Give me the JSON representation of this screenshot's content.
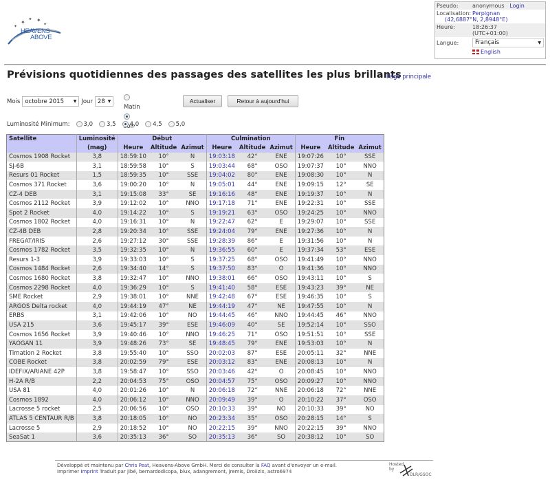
{
  "logo": {
    "line1": "HEAVENS",
    "line2": "ABOVE"
  },
  "user_panel": {
    "pseudo_label": "Pseudo:",
    "pseudo_value": "anonymous",
    "login_link": "Login",
    "location_label": "Localisation:",
    "location_value": "Perpignan",
    "coordinates": "(42,6887°N, 2,8948°E)",
    "time_label": "Heure:",
    "time_value": "18:26:37",
    "timezone": "(UTC+01:00)",
    "language_label": "Langue:",
    "language_selected": "Français",
    "english_link": "English"
  },
  "page": {
    "title": "Prévisions quotidiennes des passages des satellites les plus brillants",
    "home_link": "Page principale"
  },
  "controls": {
    "month_label": "Mois",
    "month_value": "octobre 2015",
    "day_label": "Jour",
    "day_value": "28",
    "morning_label": "Matin",
    "evening_label": "soir",
    "period_selected": "soir",
    "refresh_button": "Actualiser",
    "today_button": "Retour à aujourd'hui",
    "min_brightness_label": "Luminosité Minimum:",
    "brightness_options": [
      "3,0",
      "3,5",
      "4,0",
      "4,5",
      "5,0"
    ],
    "brightness_selected": "4,0"
  },
  "table": {
    "headers": {
      "satellite": "Satellite",
      "brightness": "Luminosité",
      "brightness_unit": "(mag)",
      "start": "Début",
      "culmination": "Culmination",
      "end": "Fin",
      "time": "Heure",
      "altitude": "Altitude",
      "azimuth": "Azimut"
    },
    "rows": [
      [
        "Cosmos 1908 Rocket",
        "3,8",
        "18:59:10",
        "10°",
        "N",
        "19:03:18",
        "42°",
        "ENE",
        "19:07:26",
        "10°",
        "SSE"
      ],
      [
        "SJ-6B",
        "3,1",
        "18:59:58",
        "10°",
        "S",
        "19:03:44",
        "68°",
        "OSO",
        "19:07:37",
        "10°",
        "NNO"
      ],
      [
        "Resurs 01 Rocket",
        "1,5",
        "18:59:35",
        "10°",
        "SSE",
        "19:04:02",
        "80°",
        "ENE",
        "19:08:30",
        "10°",
        "N"
      ],
      [
        "Cosmos 371 Rocket",
        "3,6",
        "19:00:20",
        "10°",
        "N",
        "19:05:01",
        "44°",
        "ENE",
        "19:09:15",
        "12°",
        "SE"
      ],
      [
        "CZ-4 DEB",
        "3,1",
        "19:15:08",
        "33°",
        "SE",
        "19:16:16",
        "48°",
        "ENE",
        "19:19:37",
        "10°",
        "N"
      ],
      [
        "Cosmos 2112 Rocket",
        "3,9",
        "19:12:02",
        "10°",
        "NNO",
        "19:17:18",
        "71°",
        "ENE",
        "19:22:31",
        "10°",
        "SSE"
      ],
      [
        "Spot 2 Rocket",
        "4,0",
        "19:14:22",
        "10°",
        "S",
        "19:19:21",
        "63°",
        "OSO",
        "19:24:25",
        "10°",
        "NNO"
      ],
      [
        "Cosmos 1802 Rocket",
        "4,0",
        "19:16:31",
        "10°",
        "N",
        "19:22:47",
        "62°",
        "E",
        "19:29:07",
        "10°",
        "SSE"
      ],
      [
        "CZ-4B DEB",
        "2,8",
        "19:20:34",
        "10°",
        "SSE",
        "19:24:04",
        "79°",
        "ENE",
        "19:27:36",
        "10°",
        "N"
      ],
      [
        "FREGAT/IRIS",
        "2,6",
        "19:27:12",
        "30°",
        "SSE",
        "19:28:39",
        "86°",
        "E",
        "19:31:56",
        "10°",
        "N"
      ],
      [
        "Cosmos 1782 Rocket",
        "3,5",
        "19:32:35",
        "10°",
        "N",
        "19:36:55",
        "60°",
        "E",
        "19:37:34",
        "53°",
        "ESE"
      ],
      [
        "Resurs 1-3",
        "3,9",
        "19:33:03",
        "10°",
        "S",
        "19:37:25",
        "68°",
        "OSO",
        "19:41:49",
        "10°",
        "NNO"
      ],
      [
        "Cosmos 1484 Rocket",
        "2,6",
        "19:34:40",
        "14°",
        "S",
        "19:37:50",
        "83°",
        "O",
        "19:41:36",
        "10°",
        "NNO"
      ],
      [
        "Cosmos 1680 Rocket",
        "3,8",
        "19:32:47",
        "10°",
        "NNO",
        "19:38:01",
        "66°",
        "OSO",
        "19:43:11",
        "10°",
        "S"
      ],
      [
        "Cosmos 2298 Rocket",
        "4,0",
        "19:36:29",
        "10°",
        "S",
        "19:41:40",
        "58°",
        "ESE",
        "19:43:23",
        "39°",
        "NE"
      ],
      [
        "SME Rocket",
        "2,9",
        "19:38:01",
        "10°",
        "NNE",
        "19:42:48",
        "67°",
        "ESE",
        "19:46:35",
        "10°",
        "S"
      ],
      [
        "ARGOS Delta rocket",
        "4,0",
        "19:44:19",
        "47°",
        "NE",
        "19:44:19",
        "47°",
        "NE",
        "19:47:55",
        "10°",
        "N"
      ],
      [
        "ERBS",
        "3,1",
        "19:42:06",
        "10°",
        "NO",
        "19:44:45",
        "46°",
        "NNO",
        "19:44:45",
        "46°",
        "NNO"
      ],
      [
        "USA 215",
        "3,6",
        "19:45:17",
        "39°",
        "ESE",
        "19:46:09",
        "40°",
        "SE",
        "19:52:14",
        "10°",
        "SSO"
      ],
      [
        "Cosmos 1656 Rocket",
        "3,9",
        "19:40:46",
        "10°",
        "NNO",
        "19:46:25",
        "71°",
        "OSO",
        "19:51:51",
        "10°",
        "SSE"
      ],
      [
        "YAOGAN 11",
        "3,9",
        "19:48:26",
        "73°",
        "SE",
        "19:48:45",
        "79°",
        "ENE",
        "19:53:03",
        "10°",
        "N"
      ],
      [
        "Timation 2 Rocket",
        "3,8",
        "19:55:40",
        "10°",
        "SSO",
        "20:02:03",
        "87°",
        "ESE",
        "20:05:11",
        "32°",
        "NNE"
      ],
      [
        "COBE Rocket",
        "3,8",
        "20:02:59",
        "79°",
        "ESE",
        "20:03:12",
        "83°",
        "ENE",
        "20:08:13",
        "10°",
        "N"
      ],
      [
        "IDEFIX/ARIANE 42P",
        "3,8",
        "19:58:47",
        "10°",
        "SSO",
        "20:03:46",
        "42°",
        "O",
        "20:08:45",
        "10°",
        "NNO"
      ],
      [
        "H-2A R/B",
        "2,2",
        "20:04:53",
        "75°",
        "OSO",
        "20:04:57",
        "75°",
        "OSO",
        "20:09:27",
        "10°",
        "NNO"
      ],
      [
        "USA 81",
        "4,0",
        "20:01:26",
        "10°",
        "N",
        "20:06:18",
        "72°",
        "NNE",
        "20:06:18",
        "72°",
        "NNE"
      ],
      [
        "Cosmos 1892",
        "4,0",
        "20:06:12",
        "10°",
        "NNO",
        "20:09:49",
        "39°",
        "O",
        "20:10:22",
        "37°",
        "OSO"
      ],
      [
        "Lacrosse 5 rocket",
        "2,5",
        "20:06:56",
        "10°",
        "OSO",
        "20:10:33",
        "39°",
        "NO",
        "20:10:33",
        "39°",
        "NO"
      ],
      [
        "ATLAS 5 CENTAUR R/B",
        "3,8",
        "20:18:05",
        "10°",
        "NO",
        "20:23:34",
        "35°",
        "OSO",
        "20:28:15",
        "14°",
        "S"
      ],
      [
        "Lacrosse 5",
        "2,9",
        "20:18:52",
        "10°",
        "NO",
        "20:22:15",
        "39°",
        "NNO",
        "20:22:15",
        "39°",
        "NNO"
      ],
      [
        "SeaSat 1",
        "3,6",
        "20:35:13",
        "36°",
        "SO",
        "20:35:13",
        "36°",
        "SO",
        "20:38:12",
        "10°",
        "SO"
      ]
    ]
  },
  "footer": {
    "line1_prefix": "Développé et maintenu par ",
    "author_link": "Chris Peat",
    "line1_mid": ", Heavens-Above GmbH. Merci de consulter la ",
    "faq_link": "FAQ",
    "line1_suffix": " avant d'envoyer un e-mail.",
    "line2_prefix": "Imprimer ",
    "imprint_link": "Imprint",
    "line2_suffix": " Traduit par jibé, bernardodicopa, blux, adangremont, jremis, Droiizix, astro6974",
    "hosted_by": "Hosted by",
    "host_name": "DLR/GSOC"
  },
  "colors": {
    "header_bg": "#c8c8f8",
    "link": "#3333aa",
    "row_shade": "#e2e2e2"
  }
}
